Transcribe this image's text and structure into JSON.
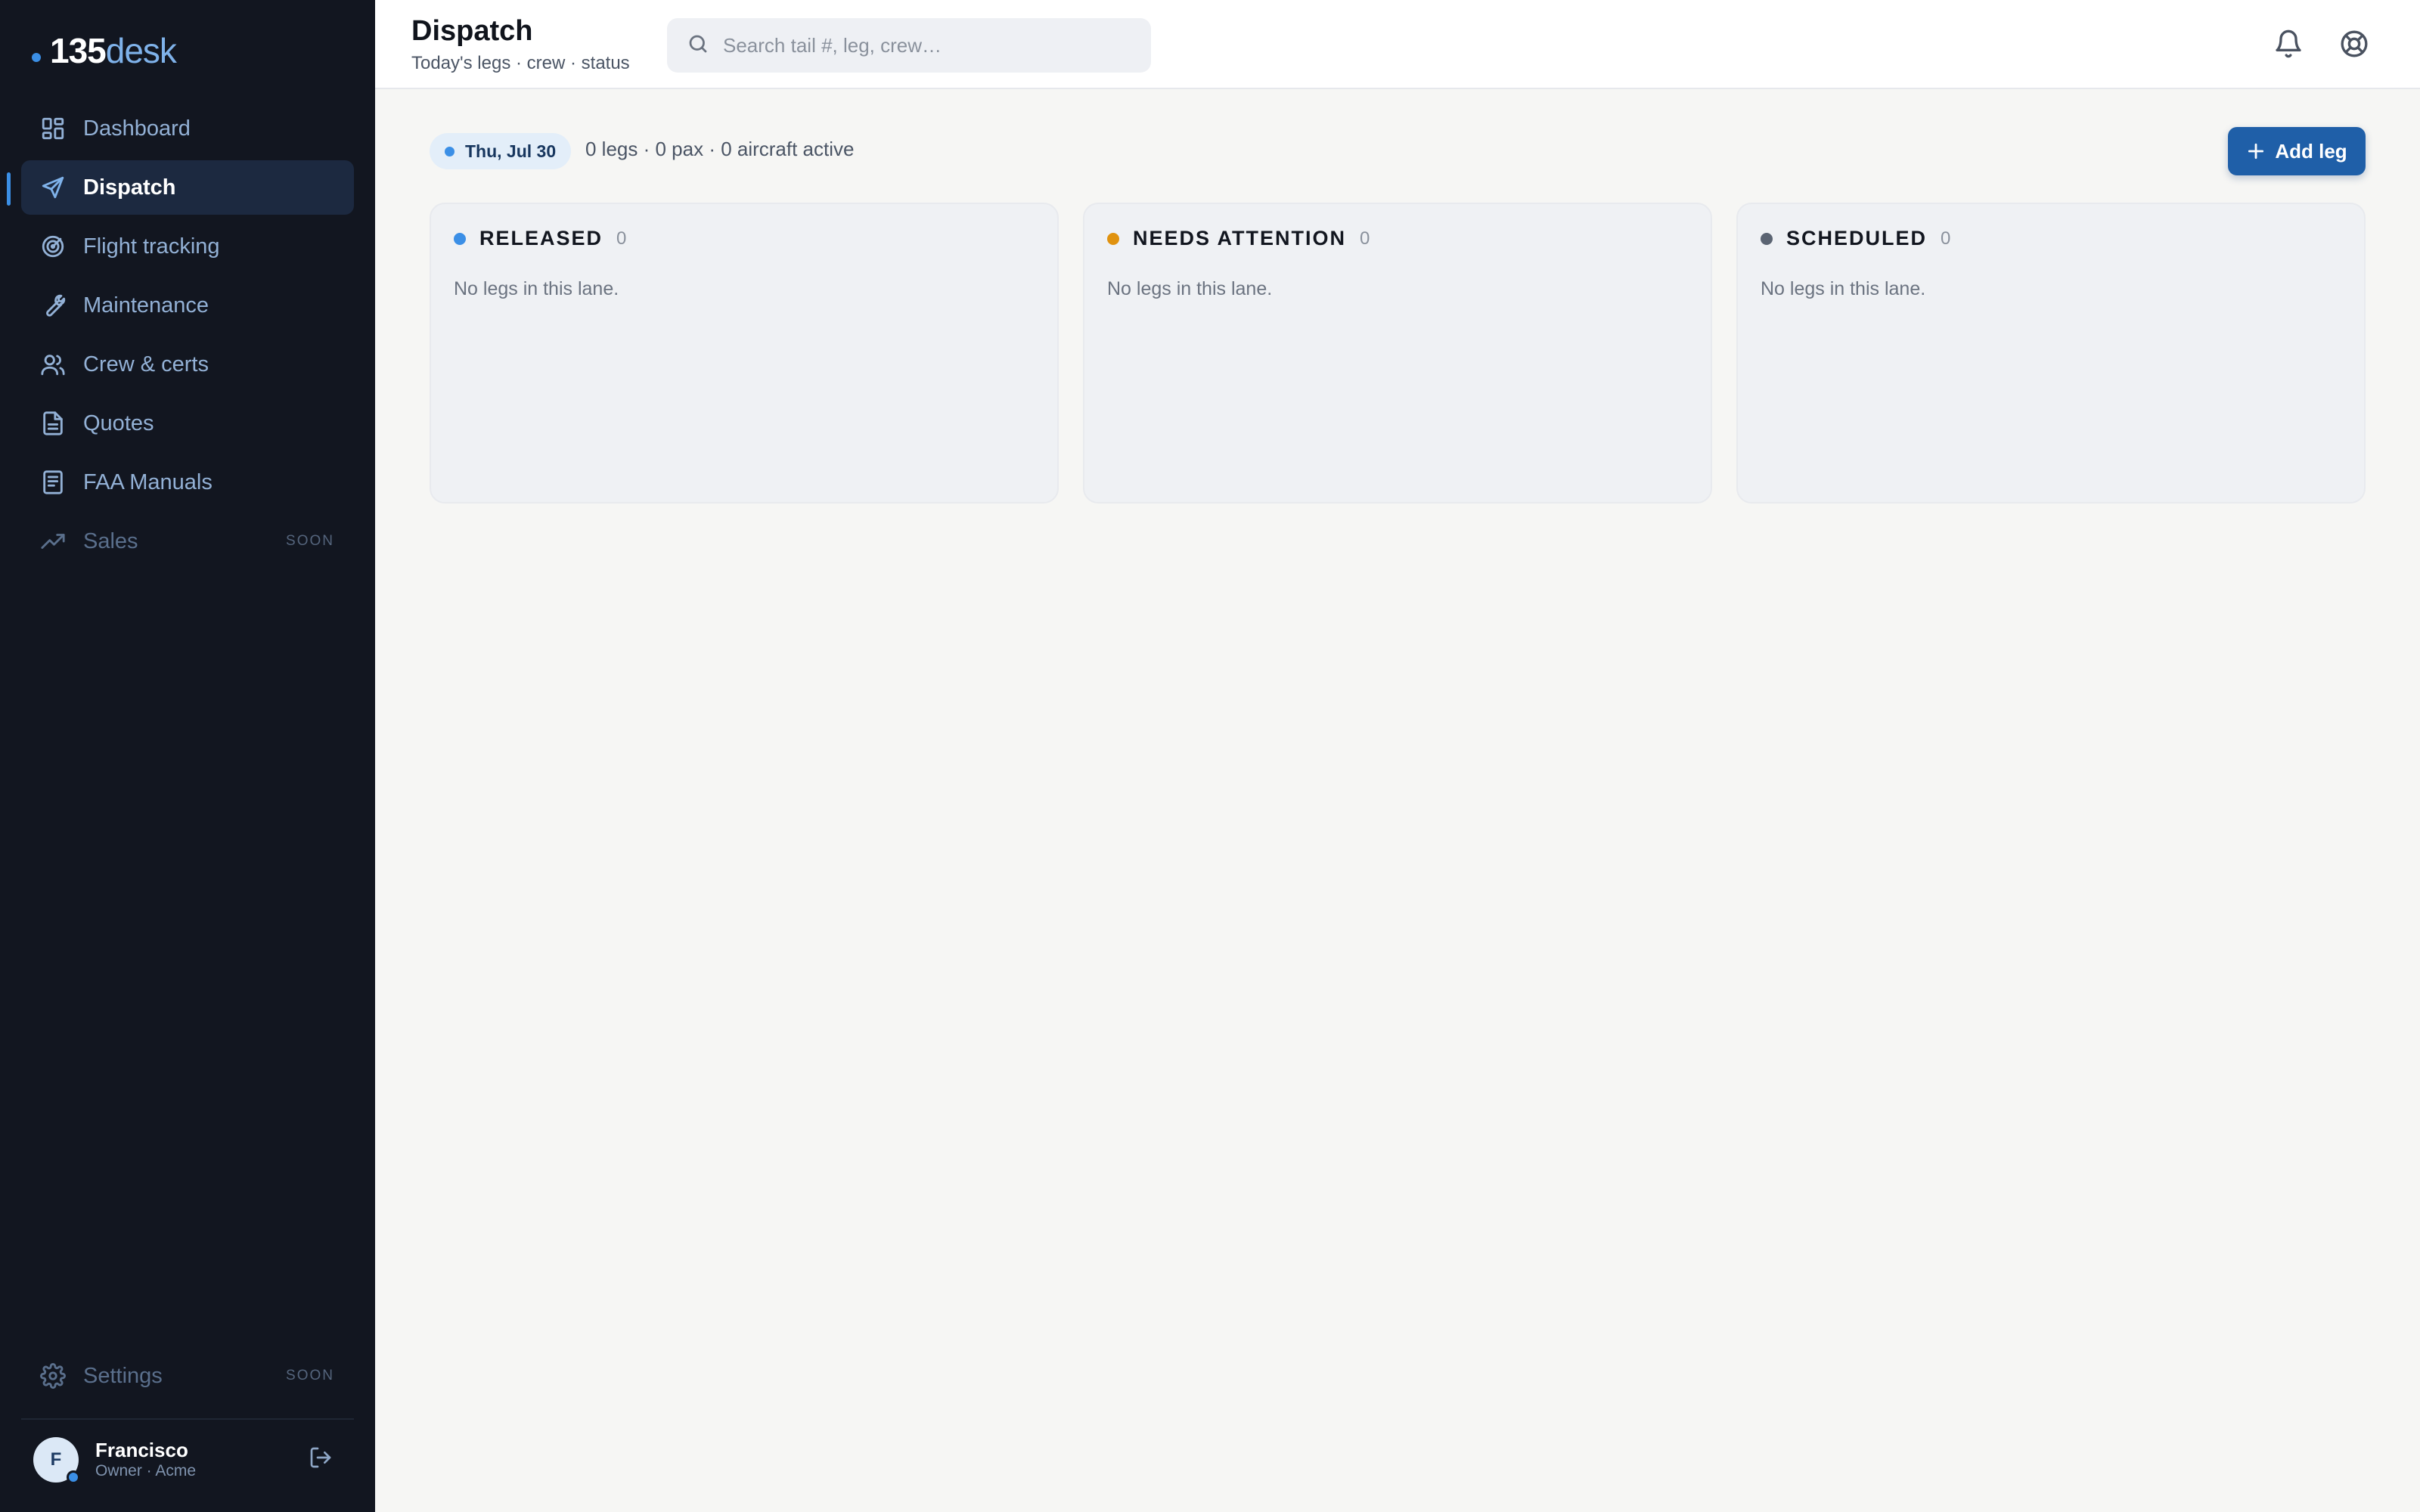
{
  "brand": {
    "part1": "135",
    "part2": "desk",
    "accent": "#3b8fe6"
  },
  "sidebar": {
    "items": [
      {
        "label": "Dashboard",
        "icon": "dashboard-icon"
      },
      {
        "label": "Dispatch",
        "icon": "send-icon",
        "active": true
      },
      {
        "label": "Flight tracking",
        "icon": "radar-icon"
      },
      {
        "label": "Maintenance",
        "icon": "wrench-icon"
      },
      {
        "label": "Crew & certs",
        "icon": "users-icon"
      },
      {
        "label": "Quotes",
        "icon": "document-icon"
      },
      {
        "label": "FAA Manuals",
        "icon": "manual-icon"
      },
      {
        "label": "Sales",
        "icon": "trending-up-icon",
        "badge": "SOON"
      }
    ],
    "settings": {
      "label": "Settings",
      "badge": "SOON",
      "icon": "gear-icon"
    },
    "user": {
      "initial": "F",
      "name": "Francisco",
      "role": "Owner · Acme"
    }
  },
  "header": {
    "title": "Dispatch",
    "subtitle": "Today's legs · crew · status",
    "search_placeholder": "Search tail #, leg, crew…"
  },
  "main": {
    "date": "Thu, Jul 30",
    "summary": "0 legs · 0 pax · 0 aircraft active",
    "add_label": "Add leg",
    "lanes": [
      {
        "title": "RELEASED",
        "count": "0",
        "empty": "No legs in this lane.",
        "color": "#3b8fe6"
      },
      {
        "title": "NEEDS ATTENTION",
        "count": "0",
        "empty": "No legs in this lane.",
        "color": "#e0920f"
      },
      {
        "title": "SCHEDULED",
        "count": "0",
        "empty": "No legs in this lane.",
        "color": "#5b6472"
      }
    ]
  }
}
